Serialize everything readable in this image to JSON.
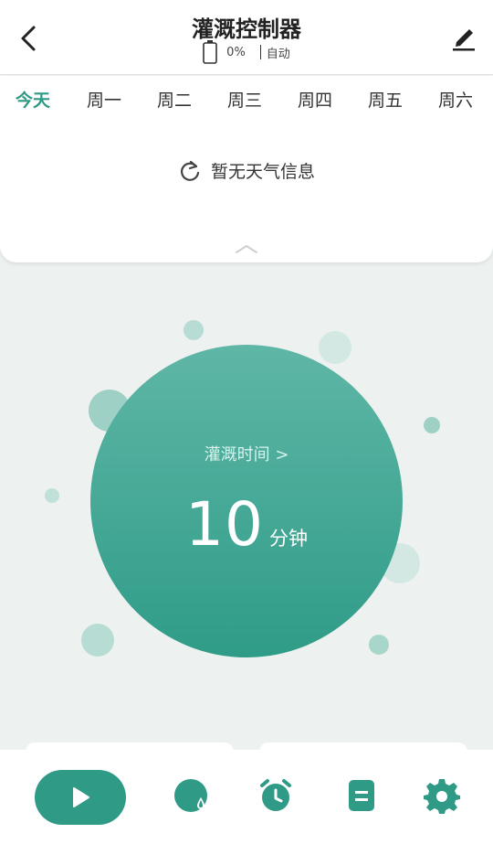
{
  "header": {
    "title": "灌溉控制器",
    "battery": "0%",
    "mode": "自动"
  },
  "days": [
    {
      "label": "今天",
      "active": true
    },
    {
      "label": "周一",
      "active": false
    },
    {
      "label": "周二",
      "active": false
    },
    {
      "label": "周三",
      "active": false
    },
    {
      "label": "周四",
      "active": false
    },
    {
      "label": "周五",
      "active": false
    },
    {
      "label": "周六",
      "active": false
    }
  ],
  "weather": {
    "message": "暂无天气信息"
  },
  "irrigation": {
    "label": "灌溉时间 >",
    "value": "10",
    "unit": "分钟"
  },
  "colors": {
    "accent": "#2e9a86",
    "background": "#edf1ef"
  },
  "bottom_nav": {
    "icons": [
      "play-icon",
      "water-usage-icon",
      "alarm-clock-icon",
      "log-icon",
      "settings-gear-icon"
    ]
  }
}
